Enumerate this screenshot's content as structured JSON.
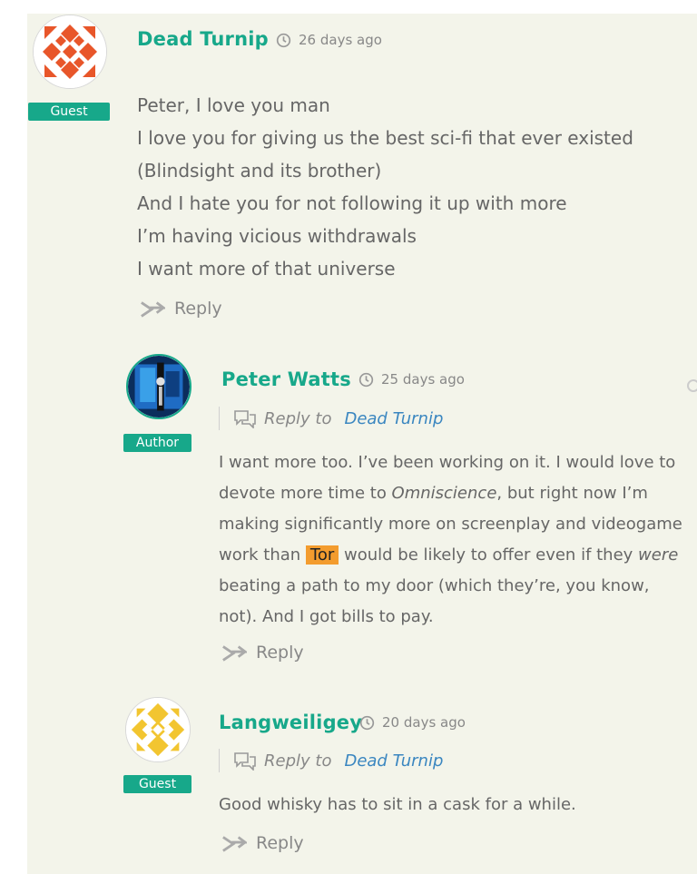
{
  "comments": [
    {
      "author": "Dead Turnip",
      "time": "26 days ago",
      "badge": "Guest",
      "lines": [
        "Peter, I love you man",
        "I love you for giving us the best sci-fi that ever existed",
        "(Blindsight and its brother)",
        "And I hate you for not following it up with more",
        "I’m having vicious withdrawals",
        "I want more of that universe"
      ],
      "reply_label": "Reply"
    },
    {
      "author": "Peter Watts",
      "time": "25 days ago",
      "badge": "Author",
      "reply_to_label": "Reply to",
      "reply_to_name": "Dead Turnip",
      "text": {
        "l1": "I want more too. I’ve been working on it. I would love to",
        "l2a": "devote more time to ",
        "l2em": "Omniscience",
        "l2b": ", but right now I’m",
        "l3": "making significantly more on screenplay and videogame",
        "l4a": "work than ",
        "l4hl": "Tor",
        "l4b": " would be likely to offer even if they ",
        "l4em": "were",
        "l5": "beating a path to my door (which they’re, you know,",
        "l6": "not). And I got bills to pay."
      },
      "reply_label": "Reply"
    },
    {
      "author": "Langweiligey",
      "time": "20 days ago",
      "badge": "Guest",
      "reply_to_label": "Reply to",
      "reply_to_name": "Dead Turnip",
      "text": "Good whisky has to sit in a cask for a while.",
      "reply_label": "Reply"
    }
  ],
  "icons": {
    "clock": "clock-icon",
    "reply": "reply-arrow-icon",
    "reply_to": "chat-bubbles-icon"
  },
  "colors": {
    "accent": "#17a88a",
    "link": "#3a86c0",
    "highlight": "#f39c2e",
    "background": "#f3f4ea"
  }
}
